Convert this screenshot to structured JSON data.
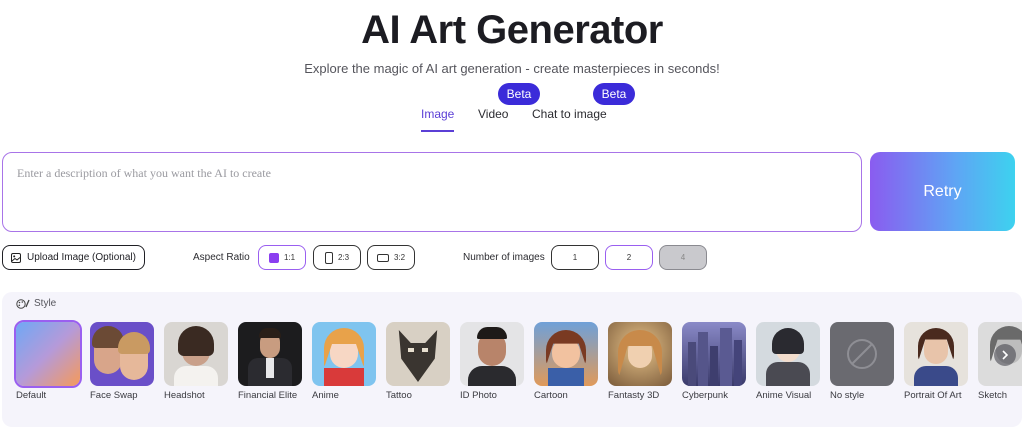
{
  "header": {
    "title": "AI Art Generator",
    "subtitle": "Explore the magic of AI art generation - create masterpieces in seconds!"
  },
  "tabs": [
    {
      "label": "Image",
      "active": true
    },
    {
      "label": "Video",
      "badge": "Beta"
    },
    {
      "label": "Chat to image",
      "badge": "Beta"
    }
  ],
  "prompt": {
    "placeholder": "Enter a description of what you want the AI to create",
    "value": ""
  },
  "retry_label": "Retry",
  "upload_label": "Upload Image (Optional)",
  "aspect_ratio": {
    "label": "Aspect Ratio",
    "options": [
      "1:1",
      "2:3",
      "3:2"
    ],
    "selected": "1:1"
  },
  "num_images": {
    "label": "Number of images",
    "options": [
      "1",
      "2",
      "4"
    ],
    "selected": "2",
    "disabled": "4"
  },
  "style": {
    "label": "Style",
    "items": [
      {
        "label": "Default",
        "selected": true
      },
      {
        "label": "Face Swap"
      },
      {
        "label": "Headshot"
      },
      {
        "label": "Financial Elite"
      },
      {
        "label": "Anime"
      },
      {
        "label": "Tattoo"
      },
      {
        "label": "ID Photo"
      },
      {
        "label": "Cartoon"
      },
      {
        "label": "Fantasty 3D"
      },
      {
        "label": "Cyberpunk"
      },
      {
        "label": "Anime Visual"
      },
      {
        "label": "No style"
      },
      {
        "label": "Portrait Of Art"
      },
      {
        "label": "Sketch"
      }
    ]
  },
  "colors": {
    "accent": "#5b3fd6",
    "badge": "#3b2bd9",
    "selected_border": "#9a5ff0"
  }
}
